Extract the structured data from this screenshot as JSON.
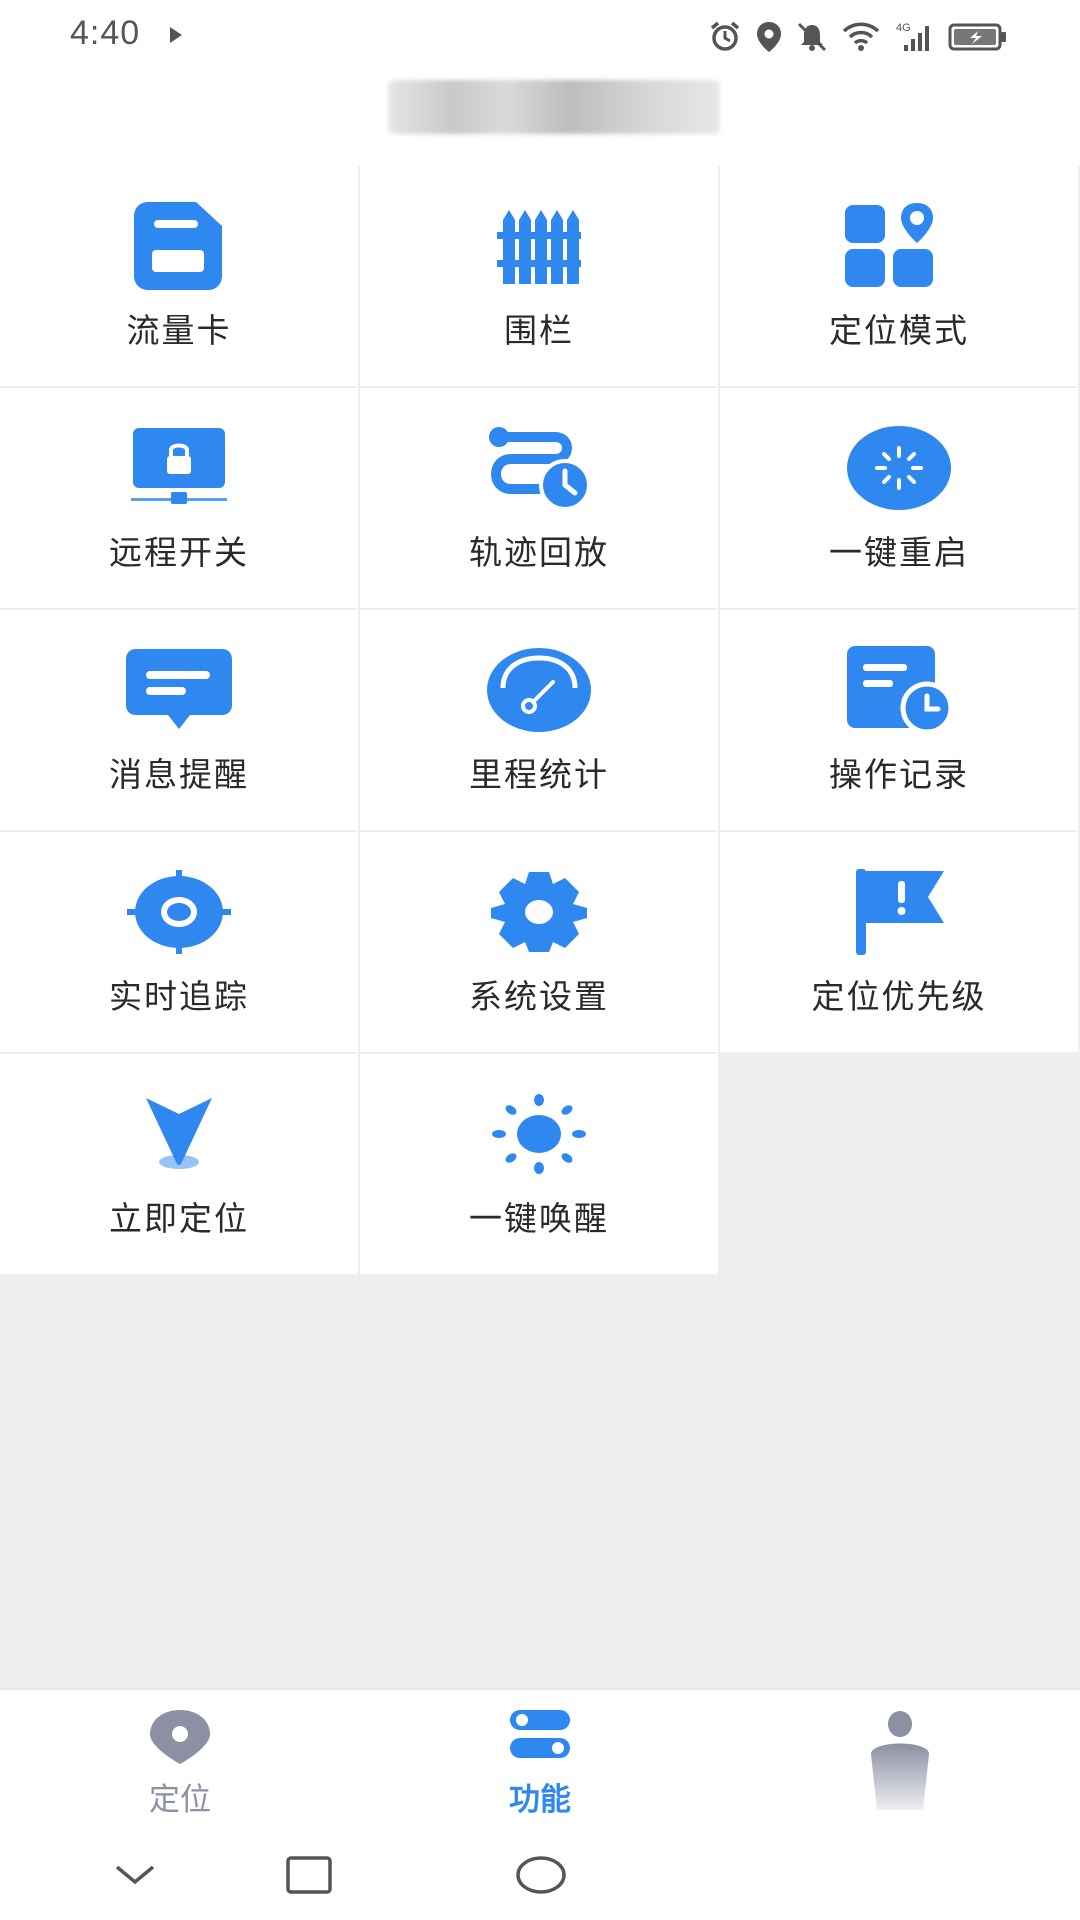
{
  "status_bar": {
    "time": "4:40",
    "network": "4G"
  },
  "header": {
    "title": ""
  },
  "grid": {
    "accent_color": "#2f88f0",
    "items": [
      {
        "label": "流量卡",
        "icon": "sim-card-icon"
      },
      {
        "label": "围栏",
        "icon": "fence-icon"
      },
      {
        "label": "定位模式",
        "icon": "location-mode-icon"
      },
      {
        "label": "远程开关",
        "icon": "remote-lock-icon"
      },
      {
        "label": "轨迹回放",
        "icon": "track-playback-icon"
      },
      {
        "label": "一键重启",
        "icon": "restart-icon"
      },
      {
        "label": "消息提醒",
        "icon": "message-icon"
      },
      {
        "label": "里程统计",
        "icon": "speedometer-icon"
      },
      {
        "label": "操作记录",
        "icon": "operation-log-icon"
      },
      {
        "label": "实时追踪",
        "icon": "realtime-tracking-icon"
      },
      {
        "label": "系统设置",
        "icon": "gear-icon"
      },
      {
        "label": "定位优先级",
        "icon": "priority-flag-icon"
      },
      {
        "label": "立即定位",
        "icon": "locate-now-icon"
      },
      {
        "label": "一键唤醒",
        "icon": "wake-sun-icon"
      }
    ]
  },
  "bottom_nav": {
    "items": [
      {
        "label": "定位",
        "icon": "location-pin-icon",
        "active": false
      },
      {
        "label": "功能",
        "icon": "toggle-features-icon",
        "active": true
      },
      {
        "label": "",
        "icon": "profile-icon",
        "active": false
      }
    ],
    "active_color": "#2f88f0",
    "inactive_color": "#8b90a2"
  }
}
